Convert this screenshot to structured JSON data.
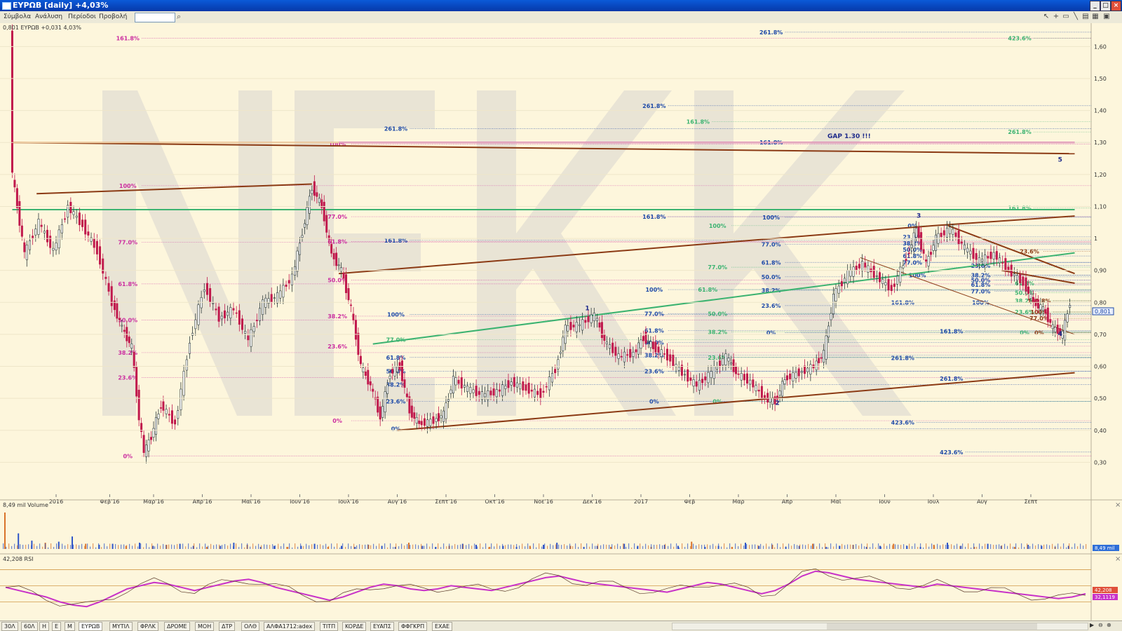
{
  "window": {
    "title": "EYPΩB [daily] +4,03%"
  },
  "menu": [
    "Σύμβολα",
    "Ανάλυση",
    "Περίοδοι",
    "Προβολή"
  ],
  "colors": {
    "bg": "#fdf6dc",
    "up": "#2d3a3a",
    "down": "#c0184c",
    "pink": "#cc2ea0",
    "blue": "#1e4aa8",
    "green": "#3cb371",
    "brown": "#8b3a14",
    "orange": "#e8a060",
    "watermark": "#e5e0d3",
    "rsi": "#c832c8"
  },
  "price_panel": {
    "legend": "0,801 EYPΩB +0,031 4,03%",
    "y_ticks": [
      {
        "label": "1,60",
        "v": 1.6
      },
      {
        "label": "1,50",
        "v": 1.5
      },
      {
        "label": "1,40",
        "v": 1.4
      },
      {
        "label": "1,30",
        "v": 1.3
      },
      {
        "label": "1,20",
        "v": 1.2
      },
      {
        "label": "1,10",
        "v": 1.1
      },
      {
        "label": "1",
        "v": 1.0
      },
      {
        "label": "0,90",
        "v": 0.9
      },
      {
        "label": "0,80",
        "v": 0.8
      },
      {
        "label": "0,70",
        "v": 0.7
      },
      {
        "label": "0,60",
        "v": 0.6
      },
      {
        "label": "0,50",
        "v": 0.5
      },
      {
        "label": "0,40",
        "v": 0.4
      },
      {
        "label": "0,30",
        "v": 0.3
      }
    ],
    "x_ticks": [
      {
        "label": "2016",
        "d": 0
      },
      {
        "label": "Φεβ'16",
        "d": 1.1
      },
      {
        "label": "Μαρ'16",
        "d": 2
      },
      {
        "label": "Απρ'16",
        "d": 3
      },
      {
        "label": "Μαϊ'16",
        "d": 4
      },
      {
        "label": "Ιουν'16",
        "d": 5
      },
      {
        "label": "Ιουλ'16",
        "d": 6
      },
      {
        "label": "Αυγ'16",
        "d": 7
      },
      {
        "label": "Σεπτ'16",
        "d": 8
      },
      {
        "label": "Οκτ'16",
        "d": 9
      },
      {
        "label": "Νοε'16",
        "d": 10
      },
      {
        "label": "Δεκ'16",
        "d": 11
      },
      {
        "label": "2017",
        "d": 12
      },
      {
        "label": "Φεβ",
        "d": 13
      },
      {
        "label": "Μαρ",
        "d": 14
      },
      {
        "label": "Απρ",
        "d": 15
      },
      {
        "label": "Μαϊ",
        "d": 16
      },
      {
        "label": "Ιουν",
        "d": 17
      },
      {
        "label": "Ιουλ",
        "d": 18
      },
      {
        "label": "Αυγ",
        "d": 19
      },
      {
        "label": "Σεπτ",
        "d": 20
      }
    ],
    "last_price": "0,801",
    "gap_note": "GAP 1.30 !!!",
    "waves": [
      {
        "label": "1",
        "d": 10.9,
        "v": 0.775
      },
      {
        "label": "2",
        "d": 14.8,
        "v": 0.48
      },
      {
        "label": "3",
        "d": 17.7,
        "v": 1.065
      },
      {
        "label": "4",
        "d": 20.6,
        "v": 0.695
      },
      {
        "label": "5",
        "d": 20.6,
        "v": 1.24
      }
    ],
    "watermark": "NEK",
    "price_series": [
      [
        -0.9,
        1.66
      ],
      [
        -0.85,
        1.2
      ],
      [
        -0.6,
        0.95
      ],
      [
        -0.3,
        1.05
      ],
      [
        0,
        0.96
      ],
      [
        0.3,
        1.1
      ],
      [
        0.6,
        1.04
      ],
      [
        0.9,
        0.96
      ],
      [
        1.2,
        0.8
      ],
      [
        1.4,
        0.72
      ],
      [
        1.6,
        0.66
      ],
      [
        1.75,
        0.44
      ],
      [
        1.85,
        0.33
      ],
      [
        2,
        0.38
      ],
      [
        2.2,
        0.48
      ],
      [
        2.5,
        0.42
      ],
      [
        2.8,
        0.68
      ],
      [
        3.1,
        0.85
      ],
      [
        3.4,
        0.75
      ],
      [
        3.7,
        0.78
      ],
      [
        4.0,
        0.68
      ],
      [
        4.3,
        0.8
      ],
      [
        4.6,
        0.82
      ],
      [
        4.9,
        0.88
      ],
      [
        5.1,
        1.02
      ],
      [
        5.3,
        1.16
      ],
      [
        5.5,
        1.1
      ],
      [
        5.7,
        0.95
      ],
      [
        5.9,
        0.9
      ],
      [
        6.1,
        0.78
      ],
      [
        6.3,
        0.6
      ],
      [
        6.5,
        0.54
      ],
      [
        6.7,
        0.44
      ],
      [
        6.9,
        0.58
      ],
      [
        7.1,
        0.6
      ],
      [
        7.3,
        0.46
      ],
      [
        7.5,
        0.42
      ],
      [
        7.8,
        0.43
      ],
      [
        8.0,
        0.45
      ],
      [
        8.2,
        0.56
      ],
      [
        8.5,
        0.53
      ],
      [
        8.8,
        0.51
      ],
      [
        9.1,
        0.52
      ],
      [
        9.4,
        0.55
      ],
      [
        9.7,
        0.53
      ],
      [
        10.0,
        0.51
      ],
      [
        10.3,
        0.59
      ],
      [
        10.5,
        0.72
      ],
      [
        10.8,
        0.73
      ],
      [
        11.1,
        0.76
      ],
      [
        11.3,
        0.68
      ],
      [
        11.6,
        0.63
      ],
      [
        11.9,
        0.64
      ],
      [
        12.1,
        0.69
      ],
      [
        12.3,
        0.66
      ],
      [
        12.6,
        0.63
      ],
      [
        12.9,
        0.58
      ],
      [
        13.2,
        0.54
      ],
      [
        13.5,
        0.58
      ],
      [
        13.8,
        0.63
      ],
      [
        14.0,
        0.58
      ],
      [
        14.3,
        0.55
      ],
      [
        14.6,
        0.5
      ],
      [
        14.8,
        0.49
      ],
      [
        15.0,
        0.56
      ],
      [
        15.3,
        0.58
      ],
      [
        15.6,
        0.6
      ],
      [
        15.8,
        0.64
      ],
      [
        16.0,
        0.82
      ],
      [
        16.3,
        0.89
      ],
      [
        16.6,
        0.92
      ],
      [
        16.9,
        0.88
      ],
      [
        17.2,
        0.84
      ],
      [
        17.5,
        0.94
      ],
      [
        17.7,
        1.03
      ],
      [
        17.9,
        0.92
      ],
      [
        18.1,
        1.0
      ],
      [
        18.4,
        1.03
      ],
      [
        18.7,
        0.97
      ],
      [
        19.0,
        0.93
      ],
      [
        19.3,
        0.95
      ],
      [
        19.6,
        0.9
      ],
      [
        19.9,
        0.86
      ],
      [
        20.1,
        0.8
      ],
      [
        20.3,
        0.78
      ],
      [
        20.5,
        0.72
      ],
      [
        20.7,
        0.7
      ],
      [
        20.85,
        0.801
      ]
    ],
    "fib_levels": [
      {
        "label": "161.8%",
        "d": 1.5,
        "v": 1.626,
        "c": "pink"
      },
      {
        "label": "100%",
        "d": 1.5,
        "v": 1.165,
        "c": "pink"
      },
      {
        "label": "77.0%",
        "d": 1.5,
        "v": 0.988,
        "c": "pink"
      },
      {
        "label": "61.8%",
        "d": 1.5,
        "v": 0.858,
        "c": "pink"
      },
      {
        "label": "50.0%",
        "d": 1.5,
        "v": 0.745,
        "c": "pink"
      },
      {
        "label": "38.2%",
        "d": 1.5,
        "v": 0.643,
        "c": "pink"
      },
      {
        "label": "23.6%",
        "d": 1.5,
        "v": 0.565,
        "c": "pink"
      },
      {
        "label": "0%",
        "d": 1.5,
        "v": 0.32,
        "c": "pink"
      },
      {
        "label": "100%",
        "d": 5.8,
        "v": 1.295,
        "c": "pink"
      },
      {
        "label": "77.0%",
        "d": 5.8,
        "v": 1.068,
        "c": "pink"
      },
      {
        "label": "61.8%",
        "d": 5.8,
        "v": 0.99,
        "c": "pink"
      },
      {
        "label": "50.0%",
        "d": 5.8,
        "v": 0.87,
        "c": "pink"
      },
      {
        "label": "38.2%",
        "d": 5.8,
        "v": 0.757,
        "c": "pink"
      },
      {
        "label": "23.6%",
        "d": 5.8,
        "v": 0.663,
        "c": "pink"
      },
      {
        "label": "0%",
        "d": 5.8,
        "v": 0.43,
        "c": "pink"
      },
      {
        "label": "261.8%",
        "d": 7.0,
        "v": 1.343,
        "c": "blue"
      },
      {
        "label": "161.8%",
        "d": 7.0,
        "v": 0.994,
        "c": "blue"
      },
      {
        "label": "100%",
        "d": 7.0,
        "v": 0.762,
        "c": "blue"
      },
      {
        "label": "77.0%",
        "d": 7.0,
        "v": 0.683,
        "c": "green"
      },
      {
        "label": "61.8%",
        "d": 7.0,
        "v": 0.628,
        "c": "blue"
      },
      {
        "label": "50.0%",
        "d": 7.0,
        "v": 0.585,
        "c": "blue"
      },
      {
        "label": "38.2%",
        "d": 7.0,
        "v": 0.543,
        "c": "blue"
      },
      {
        "label": "23.6%",
        "d": 7.0,
        "v": 0.49,
        "c": "blue"
      },
      {
        "label": "0%",
        "d": 7.0,
        "v": 0.405,
        "c": "blue"
      },
      {
        "label": "261.8%",
        "d": 12.3,
        "v": 1.415,
        "c": "blue"
      },
      {
        "label": "161.8%",
        "d": 12.3,
        "v": 1.068,
        "c": "blue"
      },
      {
        "label": "100%",
        "d": 12.3,
        "v": 0.84,
        "c": "blue"
      },
      {
        "label": "77.0%",
        "d": 12.3,
        "v": 0.765,
        "c": "blue"
      },
      {
        "label": "61.8%",
        "d": 12.3,
        "v": 0.712,
        "c": "blue"
      },
      {
        "label": "50.0%",
        "d": 12.3,
        "v": 0.675,
        "c": "blue"
      },
      {
        "label": "38.2%",
        "d": 12.3,
        "v": 0.635,
        "c": "blue"
      },
      {
        "label": "23.6%",
        "d": 12.3,
        "v": 0.585,
        "c": "blue"
      },
      {
        "label": "0%",
        "d": 12.3,
        "v": 0.49,
        "c": "blue"
      },
      {
        "label": "161.8%",
        "d": 13.2,
        "v": 1.365,
        "c": "green"
      },
      {
        "label": "100%",
        "d": 13.6,
        "v": 1.04,
        "c": "green"
      },
      {
        "label": "77.0%",
        "d": 13.6,
        "v": 0.91,
        "c": "green"
      },
      {
        "label": "61.8%",
        "d": 13.4,
        "v": 0.84,
        "c": "green"
      },
      {
        "label": "50.0%",
        "d": 13.6,
        "v": 0.765,
        "c": "green"
      },
      {
        "label": "38.2%",
        "d": 13.6,
        "v": 0.708,
        "c": "green"
      },
      {
        "label": "23.6%",
        "d": 13.6,
        "v": 0.628,
        "c": "green"
      },
      {
        "label": "0%",
        "d": 13.6,
        "v": 0.49,
        "c": "green"
      },
      {
        "label": "261.8%",
        "d": 14.7,
        "v": 1.645,
        "c": "blue"
      },
      {
        "label": "161.8%",
        "d": 14.7,
        "v": 1.3,
        "c": "blue"
      },
      {
        "label": "100%",
        "d": 14.7,
        "v": 1.066,
        "c": "blue"
      },
      {
        "label": "77.0%",
        "d": 14.7,
        "v": 0.982,
        "c": "blue"
      },
      {
        "label": "61.8%",
        "d": 14.7,
        "v": 0.925,
        "c": "blue"
      },
      {
        "label": "50.0%",
        "d": 14.7,
        "v": 0.88,
        "c": "blue"
      },
      {
        "label": "38.2%",
        "d": 14.7,
        "v": 0.838,
        "c": "blue"
      },
      {
        "label": "23.6%",
        "d": 14.7,
        "v": 0.79,
        "c": "blue"
      },
      {
        "label": "0%",
        "d": 14.7,
        "v": 0.705,
        "c": "blue"
      },
      {
        "label": "161.8%",
        "d": 17.4,
        "v": 0.8,
        "c": "blue"
      },
      {
        "label": "261.8%",
        "d": 17.4,
        "v": 0.626,
        "c": "blue"
      },
      {
        "label": "423.6%",
        "d": 17.4,
        "v": 0.425,
        "c": "blue"
      },
      {
        "label": "161.8%",
        "d": 18.4,
        "v": 0.71,
        "c": "blue"
      },
      {
        "label": "261.8%",
        "d": 18.4,
        "v": 0.562,
        "c": "blue"
      },
      {
        "label": "423.6%",
        "d": 18.4,
        "v": 0.332,
        "c": "blue"
      },
      {
        "label": "423.6%",
        "d": 19.8,
        "v": 1.626,
        "c": "green"
      },
      {
        "label": "261.8%",
        "d": 19.8,
        "v": 1.333,
        "c": "green"
      },
      {
        "label": "161.8%",
        "d": 19.8,
        "v": 1.095,
        "c": "green"
      }
    ],
    "fib_cluster": [
      {
        "label": "0%",
        "d": 17.6,
        "v": 1.04,
        "c": "blue"
      },
      {
        "label": "23.6%",
        "d": 17.6,
        "v": 1.005,
        "c": "blue"
      },
      {
        "label": "38.2%",
        "d": 17.6,
        "v": 0.985,
        "c": "blue"
      },
      {
        "label": "50.0%",
        "d": 17.6,
        "v": 0.965,
        "c": "blue"
      },
      {
        "label": "61.8%",
        "d": 17.6,
        "v": 0.945,
        "c": "blue"
      },
      {
        "label": "77.0%",
        "d": 17.6,
        "v": 0.925,
        "c": "blue"
      },
      {
        "label": "100%",
        "d": 17.7,
        "v": 0.885,
        "c": "blue"
      },
      {
        "label": "23.6%",
        "d": 19.0,
        "v": 0.915,
        "c": "blue"
      },
      {
        "label": "38.2%",
        "d": 19.0,
        "v": 0.885,
        "c": "blue"
      },
      {
        "label": "50.0%",
        "d": 19.0,
        "v": 0.87,
        "c": "blue"
      },
      {
        "label": "61.8%",
        "d": 19.0,
        "v": 0.855,
        "c": "blue"
      },
      {
        "label": "77.0%",
        "d": 19.0,
        "v": 0.835,
        "c": "blue"
      },
      {
        "label": "100%",
        "d": 19.0,
        "v": 0.8,
        "c": "blue"
      },
      {
        "label": "23.6%",
        "d": 20.0,
        "v": 0.96,
        "c": "brown"
      },
      {
        "label": "61.8%",
        "d": 19.9,
        "v": 0.86,
        "c": "green"
      },
      {
        "label": "50.0%",
        "d": 19.9,
        "v": 0.83,
        "c": "green"
      },
      {
        "label": "38.2%",
        "d": 19.9,
        "v": 0.805,
        "c": "green"
      },
      {
        "label": "23.6%",
        "d": 19.9,
        "v": 0.77,
        "c": "green"
      },
      {
        "label": "0%",
        "d": 19.9,
        "v": 0.705,
        "c": "green"
      },
      {
        "label": "161.8%",
        "d": 20.2,
        "v": 0.805,
        "c": "brown"
      },
      {
        "label": "100%",
        "d": 20.2,
        "v": 0.77,
        "c": "brown"
      },
      {
        "label": "77.0%",
        "d": 20.2,
        "v": 0.75,
        "c": "brown"
      },
      {
        "label": "0%",
        "d": 20.2,
        "v": 0.705,
        "c": "brown"
      }
    ],
    "trendlines": [
      {
        "c": "brown",
        "w": 2,
        "from": [
          -0.4,
          1.14
        ],
        "to": [
          5.25,
          1.17
        ]
      },
      {
        "c": "brown",
        "w": 2,
        "from": [
          5.8,
          0.89
        ],
        "to": [
          18.0,
          1.04
        ]
      },
      {
        "c": "brown",
        "w": 2,
        "from": [
          18.0,
          1.04
        ],
        "to": [
          20.9,
          1.07
        ]
      },
      {
        "c": "brown",
        "w": 2,
        "from": [
          7.0,
          0.4
        ],
        "to": [
          20.9,
          0.58
        ]
      },
      {
        "c": "brown",
        "w": 2,
        "from": [
          -0.9,
          1.3
        ],
        "to": [
          20.9,
          1.265
        ]
      },
      {
        "c": "brown",
        "w": 2,
        "from": [
          18.3,
          1.04
        ],
        "to": [
          20.9,
          0.89
        ]
      },
      {
        "c": "brown",
        "w": 2,
        "from": [
          19.4,
          0.9
        ],
        "to": [
          20.9,
          0.86
        ]
      },
      {
        "c": "brown",
        "w": 1,
        "from": [
          16.5,
          0.94
        ],
        "to": [
          20.9,
          0.7
        ]
      },
      {
        "c": "green",
        "w": 2,
        "from": [
          6.5,
          0.67
        ],
        "to": [
          20.9,
          0.955
        ]
      },
      {
        "c": "green",
        "w": 2,
        "from": [
          -0.9,
          1.09
        ],
        "to": [
          20.9,
          1.09
        ]
      },
      {
        "c": "orange",
        "w": 2,
        "from": [
          -0.9,
          1.3
        ],
        "to": [
          5.8,
          1.3
        ]
      },
      {
        "c": "pink",
        "w": 2,
        "from": [
          5.8,
          1.3
        ],
        "to": [
          20.9,
          1.3
        ]
      }
    ]
  },
  "volume_panel": {
    "legend": "8,49 mil Volume",
    "last_label": "8,49 mil",
    "bars": [
      3.5,
      1.5,
      0.8,
      0.6,
      0.7,
      1.2,
      0.5,
      0.4,
      0.5,
      0.3,
      0.6,
      0.3,
      0.4,
      0.5,
      0.3,
      0.2,
      0.3,
      0.6,
      0.4,
      0.2,
      0.3,
      0.2,
      0.3,
      0.5,
      0.2,
      0.3,
      0.2,
      0.4,
      0.3,
      0.2,
      0.6,
      0.3,
      0.2,
      0.3,
      0.5,
      0.4,
      0.2,
      0.3,
      0.2,
      0.3,
      0.4,
      0.6,
      0.3,
      0.2,
      0.3,
      0.2,
      0.5,
      0.3,
      0.2,
      0.4,
      0.3,
      0.7,
      0.2,
      0.3,
      0.2,
      0.6,
      0.3,
      0.4,
      0.2,
      0.3,
      0.5,
      0.2,
      0.3,
      0.4,
      0.2,
      0.3,
      0.5,
      0.3,
      0.2,
      0.4,
      0.6,
      0.3,
      0.2,
      0.5,
      0.3,
      0.2,
      0.4,
      0.3,
      0.2,
      0.3
    ]
  },
  "rsi_panel": {
    "legend": "42,208 RSI",
    "value_1": "42,208",
    "value_2": "32,1119",
    "levels": [
      70,
      50,
      30
    ],
    "series": [
      48,
      44,
      40,
      36,
      30,
      26,
      24,
      30,
      38,
      46,
      50,
      54,
      52,
      48,
      44,
      48,
      52,
      56,
      58,
      54,
      48,
      44,
      40,
      36,
      32,
      36,
      42,
      48,
      52,
      50,
      46,
      44,
      46,
      50,
      48,
      46,
      44,
      48,
      52,
      56,
      60,
      62,
      58,
      54,
      52,
      50,
      48,
      46,
      44,
      42,
      46,
      50,
      54,
      52,
      48,
      44,
      40,
      44,
      52,
      62,
      68,
      66,
      62,
      58,
      56,
      54,
      52,
      50,
      48,
      52,
      50,
      48,
      46,
      44,
      42,
      40,
      38,
      36,
      34,
      36,
      40
    ]
  },
  "tabs": [
    "30Λ",
    "60Λ",
    "H",
    "E",
    "M",
    "EYPΩB",
    "MYTIΛ",
    "ΦPΛK",
    "ΔPOME",
    "MOH",
    "ΔTP",
    "OΛΘ",
    "AΛΦA1712:adex",
    "TITΠ",
    "KOPΔE",
    "EYAΠΣ",
    "ΦΦΓKPΠ",
    "EXAE"
  ]
}
